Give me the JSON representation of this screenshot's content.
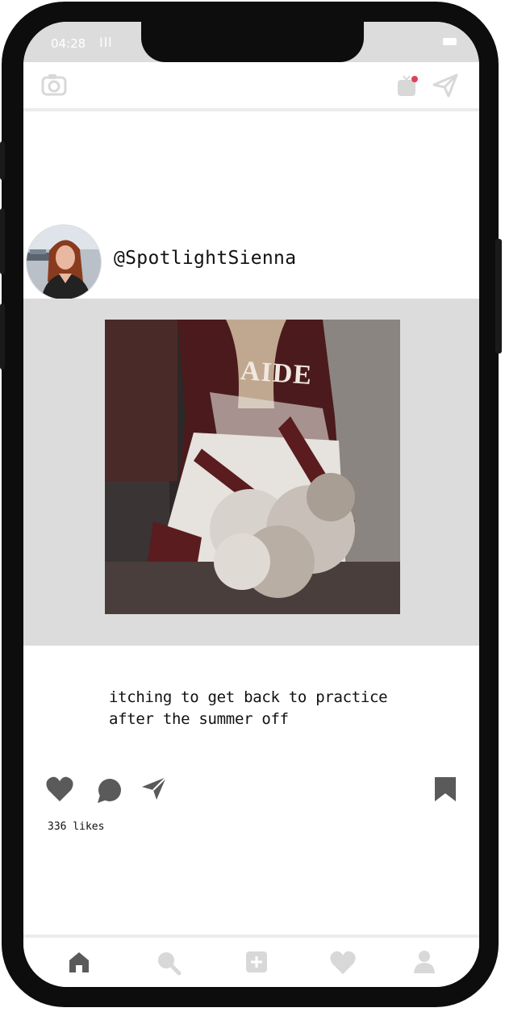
{
  "status_bar": {
    "time": "04:28",
    "signal": "Ill"
  },
  "post": {
    "username": "@SpotlightSienna",
    "caption": "itching to get back to practice after the summer off",
    "likes": "336 likes",
    "photo_text": "AIDE"
  },
  "icons": {
    "top_left": "camera-icon",
    "top_right": [
      "igtv-icon",
      "send-icon"
    ],
    "actions": [
      "heart-icon",
      "comment-icon",
      "share-icon",
      "bookmark-icon"
    ],
    "bottom_nav": [
      "home-icon",
      "search-icon",
      "add-post-icon",
      "activity-heart-icon",
      "profile-icon"
    ]
  },
  "colors": {
    "notification_dot": "#e0405a",
    "icon_gray": "#5a5a5a",
    "nav_gray": "#d8d8d8"
  }
}
